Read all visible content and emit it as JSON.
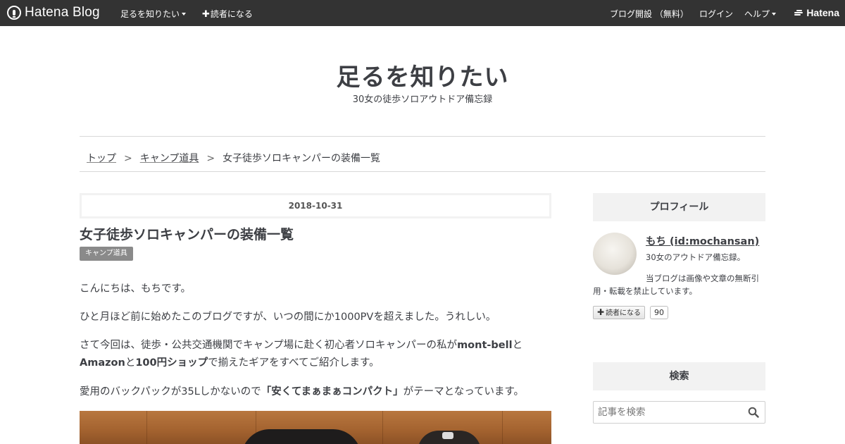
{
  "topbar": {
    "logo_text": "Hatena Blog",
    "blog_menu": "足るを知りたい",
    "subscribe": "読者になる",
    "open_blog": "ブログ開設 （無料）",
    "login": "ログイン",
    "help": "ヘルプ",
    "hatena": "Hatena"
  },
  "header": {
    "title": "足るを知りたい",
    "description": "30女の徒歩ソロアウトドア備忘録"
  },
  "breadcrumb": {
    "items": [
      "トップ",
      "キャンプ道具"
    ],
    "separator": ">",
    "current": "女子徒歩ソロキャンパーの装備一覧"
  },
  "article": {
    "date": "2018-10-31",
    "title": "女子徒歩ソロキャンパーの装備一覧",
    "category": "キャンプ道具",
    "p1": "こんにちは、もちです。",
    "p2": "ひと月ほど前に始めたこのブログですが、いつの間にか1000PVを超えました。うれしい。",
    "p3": {
      "a": "さて今回は、徒歩・公共交通機関でキャンプ場に赴く初心者ソロキャンパーの私が",
      "b": "mont-bell",
      "c": "と",
      "d": "Amazon",
      "e": "と",
      "f": "100円ショップ",
      "g": "で揃えたギアをすべてご紹介します。"
    },
    "p4": {
      "a": "愛用のバックパックが35Lしかないので",
      "b": "「安くてまぁまぁコンパクト」",
      "c": "がテーマとなっています。"
    }
  },
  "sidebar": {
    "profile_heading": "プロフィール",
    "profile_name": "もち (id:mochansan)",
    "profile_line1": "30女のアウトドア備忘録。",
    "profile_line2a": "当ブログは画像や文章の無断引",
    "profile_line2b": "用・転載を禁止しています。",
    "subscribe_label": "読者になる",
    "subscriber_count": "90",
    "search_heading": "検索",
    "search_placeholder": "記事を検索"
  },
  "colors": {
    "topbar_bg": "#333333",
    "text": "#3d3f44",
    "sidebar_heading_bg": "#f2f2f2",
    "category_bg": "#8a8a8a"
  },
  "icons": [
    "hatena-blog-logo-icon",
    "plus-icon",
    "hatena-logo-icon",
    "search-icon",
    "chevron-down-icon"
  ]
}
